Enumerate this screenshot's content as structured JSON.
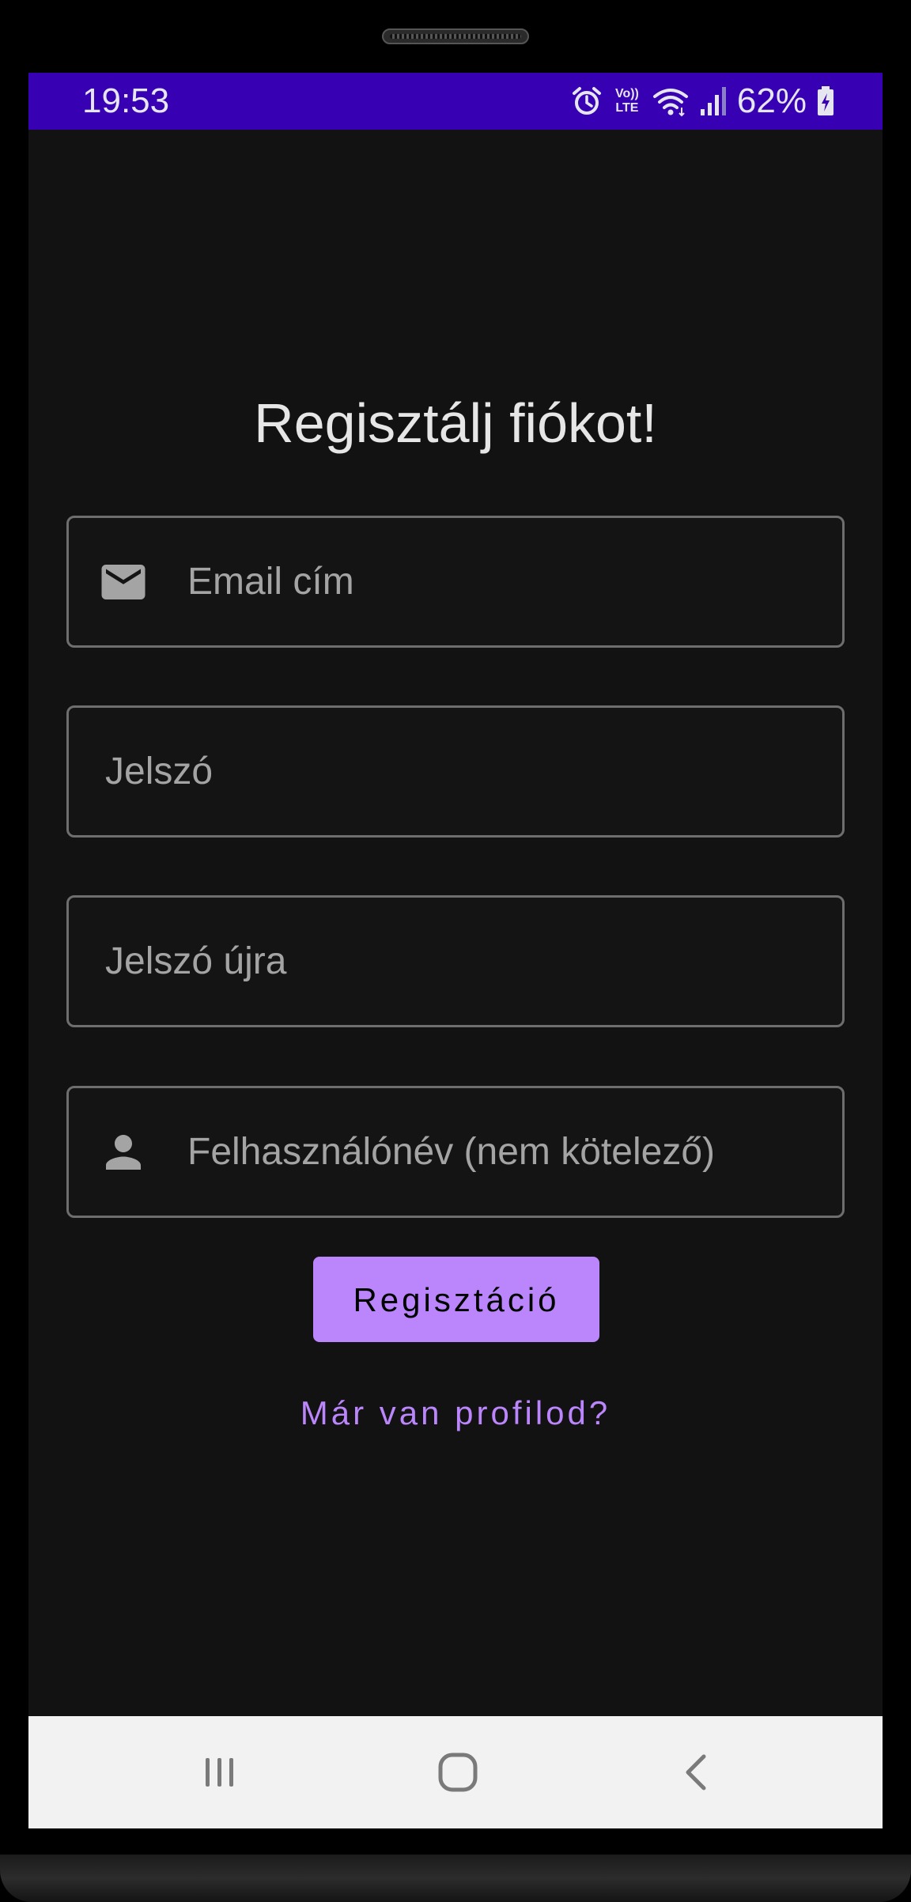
{
  "status_bar": {
    "time": "19:53",
    "battery_percent": "62%",
    "lte_label_top": "Vo))",
    "lte_label_bottom": "LTE",
    "icons": [
      "alarm-icon",
      "volte-icon",
      "wifi-icon",
      "signal-icon",
      "battery-charging-icon"
    ],
    "background_color": "#3700b3"
  },
  "form": {
    "title": "Regisztálj fiókot!",
    "email_placeholder": "Email cím",
    "password_placeholder": "Jelszó",
    "password_again_placeholder": "Jelszó újra",
    "username_placeholder": "Felhasználónév (nem kötelező)",
    "register_button": "Regisztáció",
    "login_link": "Már van profilod?",
    "icons": [
      "email-icon",
      "person-icon"
    ]
  },
  "navigation_bar": {
    "icons": [
      "recents-icon",
      "home-icon",
      "back-icon"
    ]
  },
  "colors": {
    "accent": "#bb86fc",
    "screen_background": "#121212"
  }
}
